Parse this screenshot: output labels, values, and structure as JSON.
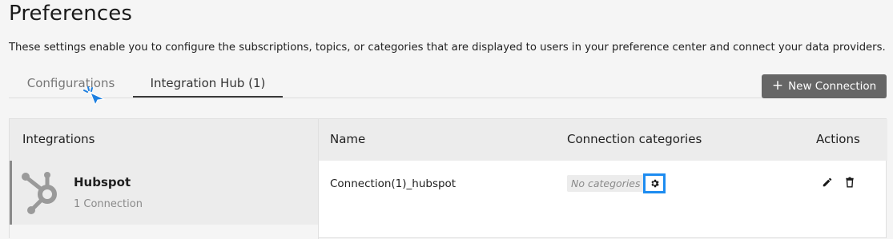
{
  "page": {
    "title": "Preferences",
    "description": "These settings enable you to configure the subscriptions, topics, or categories that are displayed to users in your preference center and connect your data providers."
  },
  "tabs": [
    {
      "label": "Configurations",
      "active": false
    },
    {
      "label": "Integration Hub (1)",
      "active": true
    }
  ],
  "toolbar": {
    "new_connection_icon": "+",
    "new_connection_label": "New Connection"
  },
  "integrations": {
    "header": "Integrations",
    "items": [
      {
        "name": "Hubspot",
        "count": "1 Connection",
        "icon": "hubspot-icon"
      }
    ]
  },
  "table": {
    "headers": {
      "name": "Name",
      "categories": "Connection categories",
      "actions": "Actions"
    },
    "rows": [
      {
        "name": "Connection(1)_hubspot",
        "categories": "No categories"
      }
    ]
  },
  "colors": {
    "accent": "#1d8cf0",
    "button_bg": "#666666"
  }
}
